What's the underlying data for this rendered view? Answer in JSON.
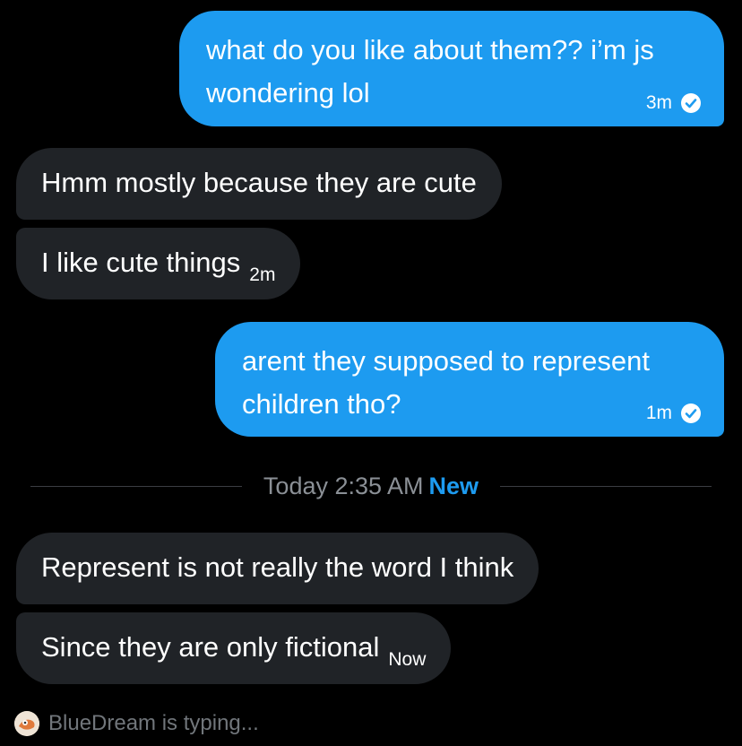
{
  "messages": [
    {
      "direction": "sent",
      "text": "what do you like about them?? i’m js wondering lol",
      "time": "3m",
      "status_icon": "check-circle-icon"
    },
    {
      "direction": "received",
      "text": "Hmm mostly because they are cute",
      "time": ""
    },
    {
      "direction": "received",
      "text": "I like cute things",
      "time": "2m"
    },
    {
      "direction": "sent",
      "text": "arent they supposed to represent children tho?",
      "time": "1m",
      "status_icon": "check-circle-icon"
    },
    {
      "direction": "received",
      "text": "Represent is not really the word I think",
      "time": ""
    },
    {
      "direction": "received",
      "text": "Since they are only fictional",
      "time": "Now"
    }
  ],
  "divider": {
    "label": "Today 2:35 AM",
    "badge": "New"
  },
  "typing": {
    "text": "BlueDream is typing...",
    "avatar_icon": "user-avatar-icon"
  },
  "colors": {
    "sent_bubble": "#1d9bf0",
    "received_bubble": "#202327",
    "background": "#000000",
    "accent": "#1d9bf0"
  }
}
